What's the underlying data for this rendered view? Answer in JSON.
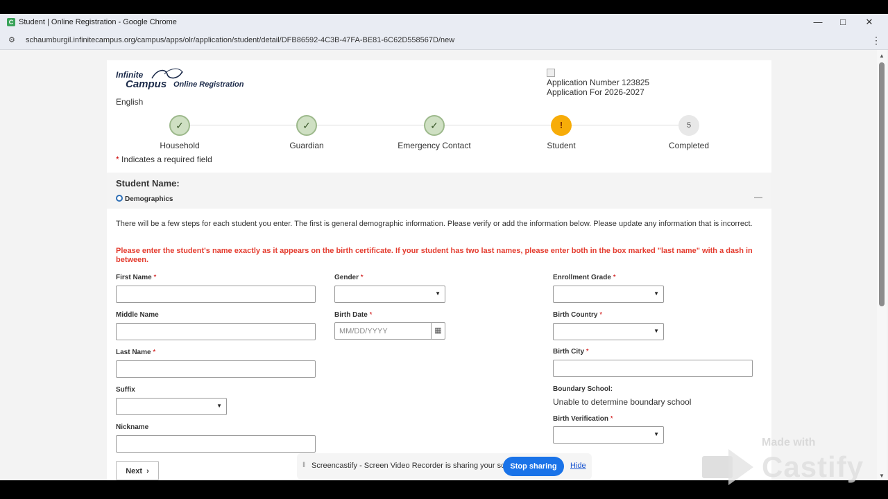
{
  "browser": {
    "title": "Student | Online Registration - Google Chrome",
    "url": "schaumburgil.infinitecampus.org/campus/apps/olr/application/student/detail/DFB86592-4C3B-47FA-BE81-6C62D558567D/new",
    "minimize": "—",
    "maximize": "□",
    "close": "✕"
  },
  "header": {
    "logo_line1": "Infinite",
    "logo_line2": "Campus",
    "logo_line3": "Online Registration",
    "language": "English",
    "application_number": "Application Number 123825",
    "application_for": "Application For 2026-2027"
  },
  "steps": [
    {
      "label": "Household",
      "state": "done",
      "symbol": "✓"
    },
    {
      "label": "Guardian",
      "state": "done",
      "symbol": "✓"
    },
    {
      "label": "Emergency Contact",
      "state": "done",
      "symbol": "✓"
    },
    {
      "label": "Student",
      "state": "current",
      "symbol": "!"
    },
    {
      "label": "Completed",
      "state": "todo",
      "symbol": "5"
    }
  ],
  "required_note": "Indicates a required field",
  "section": {
    "student_name_label": "Student Name:",
    "subsection": "Demographics",
    "collapse_symbol": "—"
  },
  "intro_text": "There will be a few steps for each student you enter. The first is general demographic information. Please verify or add the information below. Please update any information that is incorrect.",
  "warning_text": "Please enter the student's name exactly as it appears on the birth certificate. If your student has two last names, please enter both in the box marked \"last name\" with a dash in between.",
  "fields": {
    "first_name": "First Name",
    "middle_name": "Middle Name",
    "last_name": "Last Name",
    "suffix": "Suffix",
    "nickname": "Nickname",
    "gender": "Gender",
    "birth_date": "Birth Date",
    "birth_date_placeholder": "MM/DD/YYYY",
    "enrollment_grade": "Enrollment Grade",
    "birth_country": "Birth Country",
    "birth_city": "Birth City",
    "boundary_school": "Boundary School:",
    "boundary_school_value": "Unable to determine boundary school",
    "birth_verification": "Birth Verification",
    "required_star": "*"
  },
  "next_button": "Next",
  "share_bar": {
    "message": "Screencastify - Screen Video Recorder is sharing your screen.",
    "stop": "Stop sharing",
    "hide": "Hide"
  },
  "watermark": {
    "made_with": "Made with",
    "brand": "Castify"
  }
}
